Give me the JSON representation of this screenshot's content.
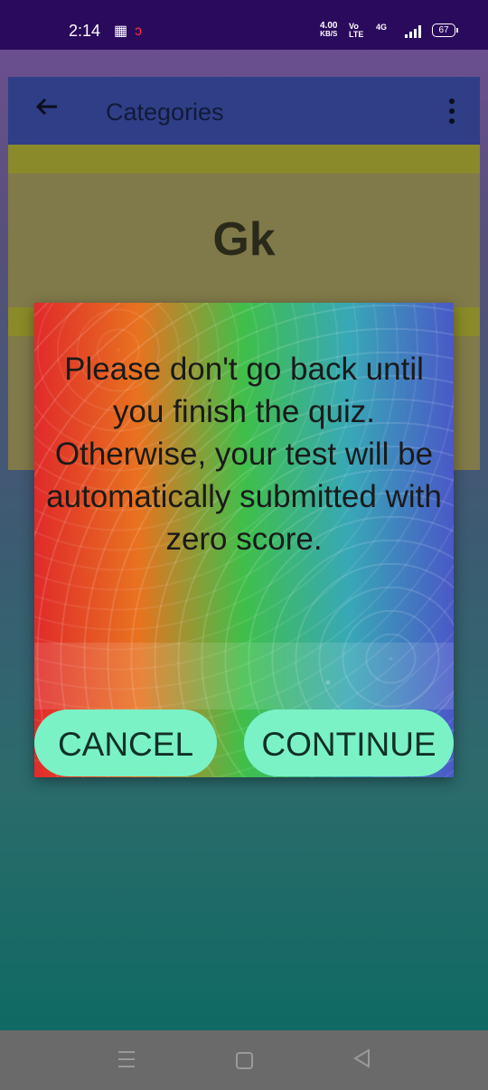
{
  "status_bar": {
    "time": "2:14",
    "speed_value": "4.00",
    "speed_unit": "KB/S",
    "volte_top": "Vo",
    "volte_bottom": "LTE",
    "network": "4G",
    "battery": "67"
  },
  "app_bar": {
    "title": "Categories"
  },
  "card": {
    "label": "Gk"
  },
  "dialog": {
    "message": "Please don't go back until you finish the quiz. Otherwise, your test will be automatically submitted with zero score.",
    "cancel_label": "CANCEL",
    "continue_label": "CONTINUE"
  }
}
